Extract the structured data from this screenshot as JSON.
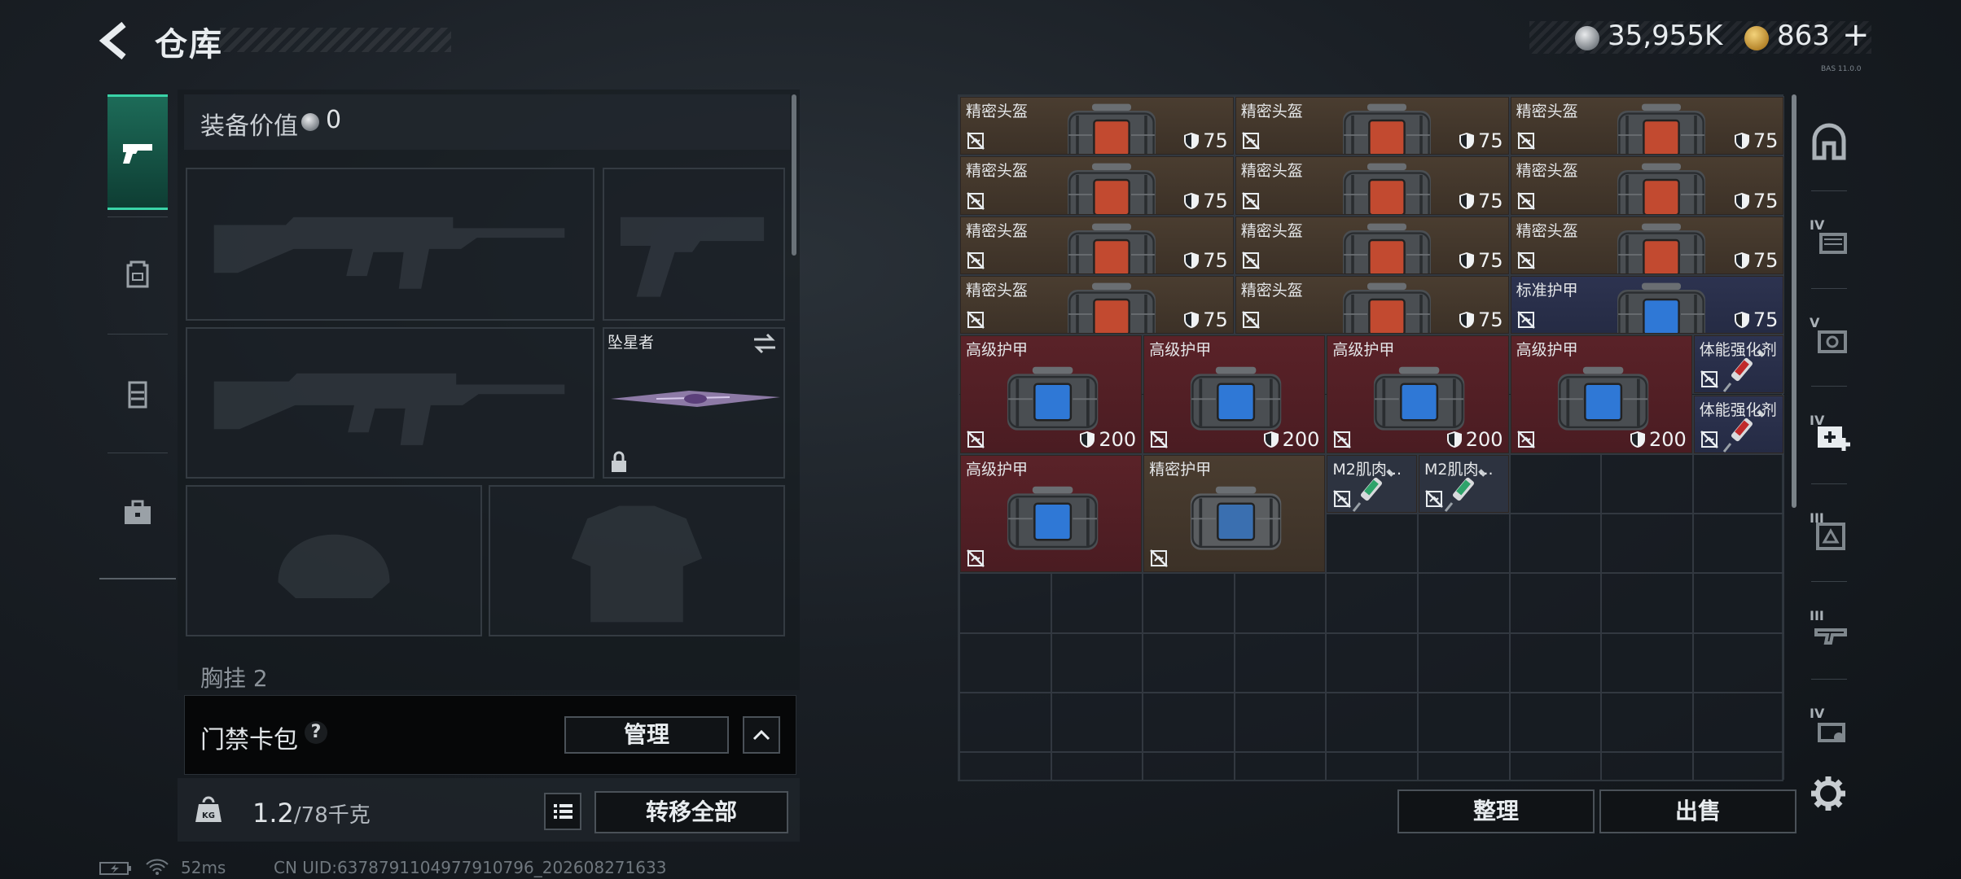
{
  "header": {
    "title": "仓库",
    "silver": "35,955K",
    "gold": "863",
    "plus": "+",
    "version": "BAS 11.0.0"
  },
  "left_tabs": [
    {
      "icon": "pistol-icon",
      "active": true
    },
    {
      "icon": "backpack-icon",
      "active": false
    },
    {
      "icon": "vest-icon",
      "active": false
    },
    {
      "icon": "briefcase-icon",
      "active": false
    }
  ],
  "equipment": {
    "value_label": "装备价值",
    "value": "0",
    "melee_name": "坠星者",
    "chest_label": "胸挂",
    "chest_count": "2"
  },
  "keycard": {
    "label": "门禁卡包",
    "help": "?",
    "manage": "管理"
  },
  "bottom": {
    "weight_current": "1.2",
    "weight_max": "/78千克",
    "transfer_all": "转移全部"
  },
  "status": {
    "ping": "52ms",
    "uid": "CN UID:6378791104977910796_202608271633"
  },
  "stash": {
    "items": [
      {
        "name": "精密头盔",
        "value": "75",
        "type": "helmet",
        "color": "brown",
        "c": 0,
        "r": 0,
        "w": 3,
        "h": 1
      },
      {
        "name": "精密头盔",
        "value": "75",
        "type": "helmet",
        "color": "brown",
        "c": 3,
        "r": 0,
        "w": 3,
        "h": 1
      },
      {
        "name": "精密头盔",
        "value": "75",
        "type": "helmet",
        "color": "brown",
        "c": 6,
        "r": 0,
        "w": 3,
        "h": 1
      },
      {
        "name": "精密头盔",
        "value": "75",
        "type": "helmet",
        "color": "brown",
        "c": 0,
        "r": 1,
        "w": 3,
        "h": 1
      },
      {
        "name": "精密头盔",
        "value": "75",
        "type": "helmet",
        "color": "brown",
        "c": 3,
        "r": 1,
        "w": 3,
        "h": 1
      },
      {
        "name": "精密头盔",
        "value": "75",
        "type": "helmet",
        "color": "brown",
        "c": 6,
        "r": 1,
        "w": 3,
        "h": 1
      },
      {
        "name": "精密头盔",
        "value": "75",
        "type": "helmet",
        "color": "brown",
        "c": 0,
        "r": 2,
        "w": 3,
        "h": 1
      },
      {
        "name": "精密头盔",
        "value": "75",
        "type": "helmet",
        "color": "brown",
        "c": 3,
        "r": 2,
        "w": 3,
        "h": 1
      },
      {
        "name": "精密头盔",
        "value": "75",
        "type": "helmet",
        "color": "brown",
        "c": 6,
        "r": 2,
        "w": 3,
        "h": 1
      },
      {
        "name": "精密头盔",
        "value": "75",
        "type": "helmet",
        "color": "brown",
        "c": 0,
        "r": 3,
        "w": 3,
        "h": 1
      },
      {
        "name": "精密头盔",
        "value": "75",
        "type": "helmet",
        "color": "brown",
        "c": 3,
        "r": 3,
        "w": 3,
        "h": 1
      },
      {
        "name": "标准护甲",
        "value": "75",
        "type": "armor",
        "color": "blue",
        "c": 6,
        "r": 3,
        "w": 3,
        "h": 1
      },
      {
        "name": "高级护甲",
        "value": "200",
        "type": "armor",
        "color": "red",
        "c": 0,
        "r": 4,
        "w": 2,
        "h": 2
      },
      {
        "name": "高级护甲",
        "value": "200",
        "type": "armor",
        "color": "red",
        "c": 2,
        "r": 4,
        "w": 2,
        "h": 2
      },
      {
        "name": "高级护甲",
        "value": "200",
        "type": "armor",
        "color": "red",
        "c": 4,
        "r": 4,
        "w": 2,
        "h": 2
      },
      {
        "name": "高级护甲",
        "value": "200",
        "type": "armor",
        "color": "red",
        "c": 6,
        "r": 4,
        "w": 2,
        "h": 2
      },
      {
        "name": "体能强化剂",
        "value": "",
        "type": "injector-red",
        "color": "blue",
        "c": 8,
        "r": 4,
        "w": 1,
        "h": 1
      },
      {
        "name": "体能强化剂",
        "value": "",
        "type": "injector-red",
        "color": "blue",
        "c": 8,
        "r": 5,
        "w": 1,
        "h": 1
      },
      {
        "name": "高级护甲",
        "value": "",
        "type": "armor",
        "color": "red",
        "c": 0,
        "r": 6,
        "w": 2,
        "h": 2
      },
      {
        "name": "精密护甲",
        "value": "",
        "type": "armor-gray",
        "color": "brown",
        "c": 2,
        "r": 6,
        "w": 2,
        "h": 2
      },
      {
        "name": "M2肌肉...",
        "value": "",
        "type": "injector-green",
        "color": "gray",
        "c": 4,
        "r": 6,
        "w": 1,
        "h": 1
      },
      {
        "name": "M2肌肉...",
        "value": "",
        "type": "injector-green",
        "color": "gray",
        "c": 5,
        "r": 6,
        "w": 1,
        "h": 1
      }
    ],
    "sort": "整理",
    "sell": "出售"
  },
  "right_tabs": [
    {
      "icon": "stash-home-icon",
      "level": ""
    },
    {
      "icon": "stash-iv-case-icon",
      "level": "IV"
    },
    {
      "icon": "stash-v-safe-icon",
      "level": "V"
    },
    {
      "icon": "stash-iv-medkit-icon",
      "level": "IV"
    },
    {
      "icon": "stash-iii-ammo-icon",
      "level": "III"
    },
    {
      "icon": "stash-iii-gun-icon",
      "level": "III"
    },
    {
      "icon": "stash-iv-key-icon",
      "level": "IV"
    }
  ],
  "colors": {
    "accent": "#3ad4a8",
    "brown_item": "#4a3d30",
    "red_item": "#5a2228",
    "blue_item": "#2d3350"
  }
}
